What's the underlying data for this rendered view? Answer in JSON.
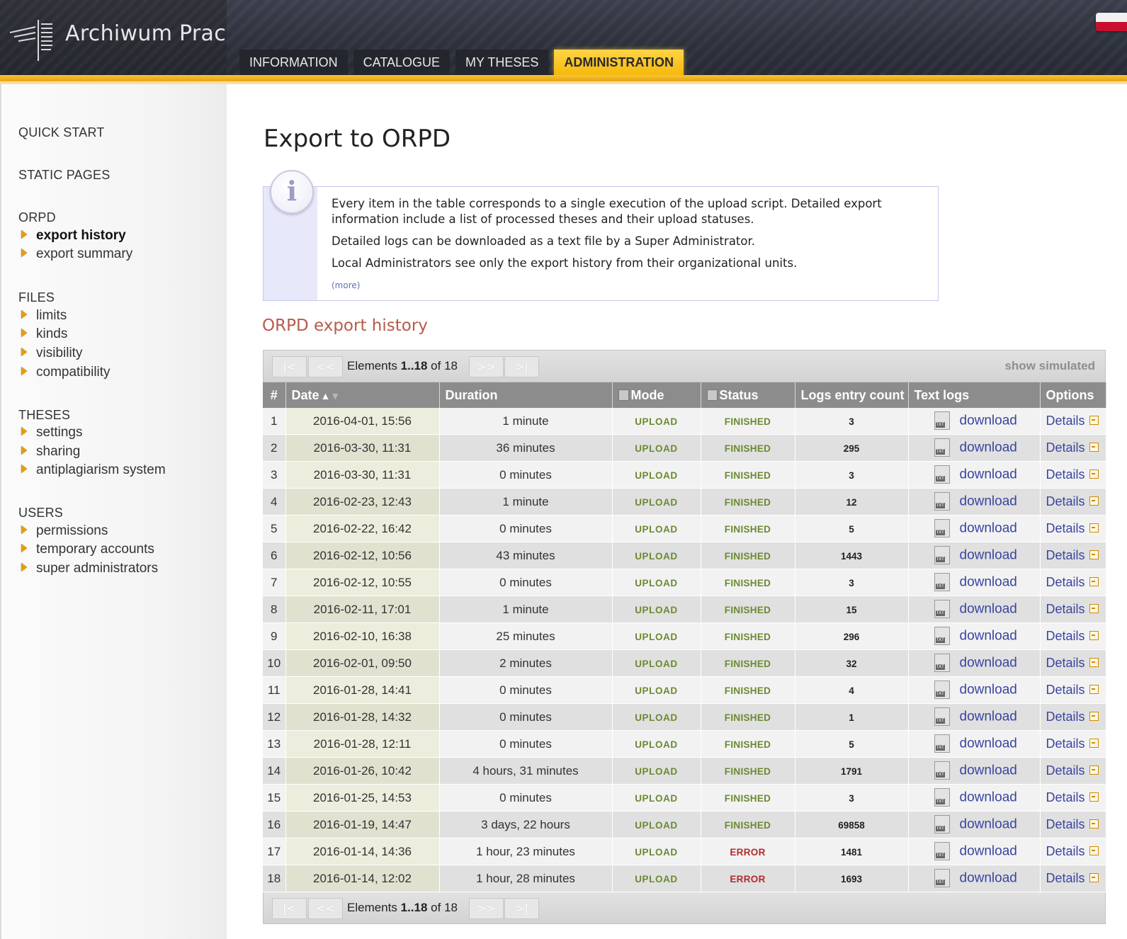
{
  "app": {
    "name": "Archiwum Prac"
  },
  "tabs": [
    {
      "label": "INFORMATION",
      "active": false
    },
    {
      "label": "CATALOGUE",
      "active": false
    },
    {
      "label": "MY THESES",
      "active": false
    },
    {
      "label": "ADMINISTRATION",
      "active": true
    }
  ],
  "sidebar": {
    "quick_start": "QUICK START",
    "static_pages": "STATIC PAGES",
    "orpd": {
      "title": "ORPD",
      "items": [
        "export history",
        "export summary"
      ],
      "current": "export history"
    },
    "files": {
      "title": "FILES",
      "items": [
        "limits",
        "kinds",
        "visibility",
        "compatibility"
      ]
    },
    "theses": {
      "title": "THESES",
      "items": [
        "settings",
        "sharing",
        "antiplagiarism system"
      ]
    },
    "users": {
      "title": "USERS",
      "items": [
        "permissions",
        "temporary accounts",
        "super administrators"
      ]
    }
  },
  "page": {
    "title": "Export to ORPD",
    "info": {
      "p1": "Every item in the table corresponds to a single execution of the upload script. Detailed export information include a list of processed theses and their upload statuses.",
      "p2": "Detailed logs can be downloaded as a text file by a Super Administrator.",
      "p3": "Local Administrators see only the export history from their organizational units.",
      "more": "(more)"
    },
    "section_title": "ORPD export history"
  },
  "pager": {
    "first": "|<",
    "prev": "<<",
    "next": ">>",
    "last": ">|",
    "elements_label": "Elements",
    "range": "1..18",
    "of_label": "of",
    "total": "18",
    "show_simulated": "show simulated"
  },
  "table": {
    "headers": {
      "num": "#",
      "date": "Date",
      "duration": "Duration",
      "mode": "Mode",
      "status": "Status",
      "logs": "Logs entry count",
      "text_logs": "Text logs",
      "options": "Options"
    },
    "download_label": "download",
    "details_label": "Details",
    "rows": [
      {
        "n": "1",
        "date": "2016-04-01, 15:56",
        "duration": "1 minute",
        "mode": "UPLOAD",
        "status": "FINISHED",
        "logs": "3"
      },
      {
        "n": "2",
        "date": "2016-03-30, 11:31",
        "duration": "36 minutes",
        "mode": "UPLOAD",
        "status": "FINISHED",
        "logs": "295"
      },
      {
        "n": "3",
        "date": "2016-03-30, 11:31",
        "duration": "0 minutes",
        "mode": "UPLOAD",
        "status": "FINISHED",
        "logs": "3"
      },
      {
        "n": "4",
        "date": "2016-02-23, 12:43",
        "duration": "1 minute",
        "mode": "UPLOAD",
        "status": "FINISHED",
        "logs": "12"
      },
      {
        "n": "5",
        "date": "2016-02-22, 16:42",
        "duration": "0 minutes",
        "mode": "UPLOAD",
        "status": "FINISHED",
        "logs": "5"
      },
      {
        "n": "6",
        "date": "2016-02-12, 10:56",
        "duration": "43 minutes",
        "mode": "UPLOAD",
        "status": "FINISHED",
        "logs": "1443"
      },
      {
        "n": "7",
        "date": "2016-02-12, 10:55",
        "duration": "0 minutes",
        "mode": "UPLOAD",
        "status": "FINISHED",
        "logs": "3"
      },
      {
        "n": "8",
        "date": "2016-02-11, 17:01",
        "duration": "1 minute",
        "mode": "UPLOAD",
        "status": "FINISHED",
        "logs": "15"
      },
      {
        "n": "9",
        "date": "2016-02-10, 16:38",
        "duration": "25 minutes",
        "mode": "UPLOAD",
        "status": "FINISHED",
        "logs": "296"
      },
      {
        "n": "10",
        "date": "2016-02-01, 09:50",
        "duration": "2 minutes",
        "mode": "UPLOAD",
        "status": "FINISHED",
        "logs": "32"
      },
      {
        "n": "11",
        "date": "2016-01-28, 14:41",
        "duration": "0 minutes",
        "mode": "UPLOAD",
        "status": "FINISHED",
        "logs": "4"
      },
      {
        "n": "12",
        "date": "2016-01-28, 14:32",
        "duration": "0 minutes",
        "mode": "UPLOAD",
        "status": "FINISHED",
        "logs": "1"
      },
      {
        "n": "13",
        "date": "2016-01-28, 12:11",
        "duration": "0 minutes",
        "mode": "UPLOAD",
        "status": "FINISHED",
        "logs": "5"
      },
      {
        "n": "14",
        "date": "2016-01-26, 10:42",
        "duration": "4 hours, 31 minutes",
        "mode": "UPLOAD",
        "status": "FINISHED",
        "logs": "1791"
      },
      {
        "n": "15",
        "date": "2016-01-25, 14:53",
        "duration": "0 minutes",
        "mode": "UPLOAD",
        "status": "FINISHED",
        "logs": "3"
      },
      {
        "n": "16",
        "date": "2016-01-19, 14:47",
        "duration": "3 days, 22 hours",
        "mode": "UPLOAD",
        "status": "FINISHED",
        "logs": "69858"
      },
      {
        "n": "17",
        "date": "2016-01-14, 14:36",
        "duration": "1 hour, 23 minutes",
        "mode": "UPLOAD",
        "status": "ERROR",
        "logs": "1481"
      },
      {
        "n": "18",
        "date": "2016-01-14, 12:02",
        "duration": "1 hour, 28 minutes",
        "mode": "UPLOAD",
        "status": "ERROR",
        "logs": "1693"
      }
    ]
  },
  "colors": {
    "accent_gold": "#f5b90c",
    "status_ok": "#6a8a32",
    "status_error": "#b32a2a",
    "link": "#3a45a0",
    "section_title": "#b85a4a"
  },
  "icons": {
    "logo": "antenna-logo-icon",
    "info": "info-icon",
    "menu_bullet": "arrow-right-icon",
    "text_file": "txt-file-icon",
    "external": "external-link-icon",
    "filter": "filter-icon",
    "sort": "sort-asc-icon"
  }
}
